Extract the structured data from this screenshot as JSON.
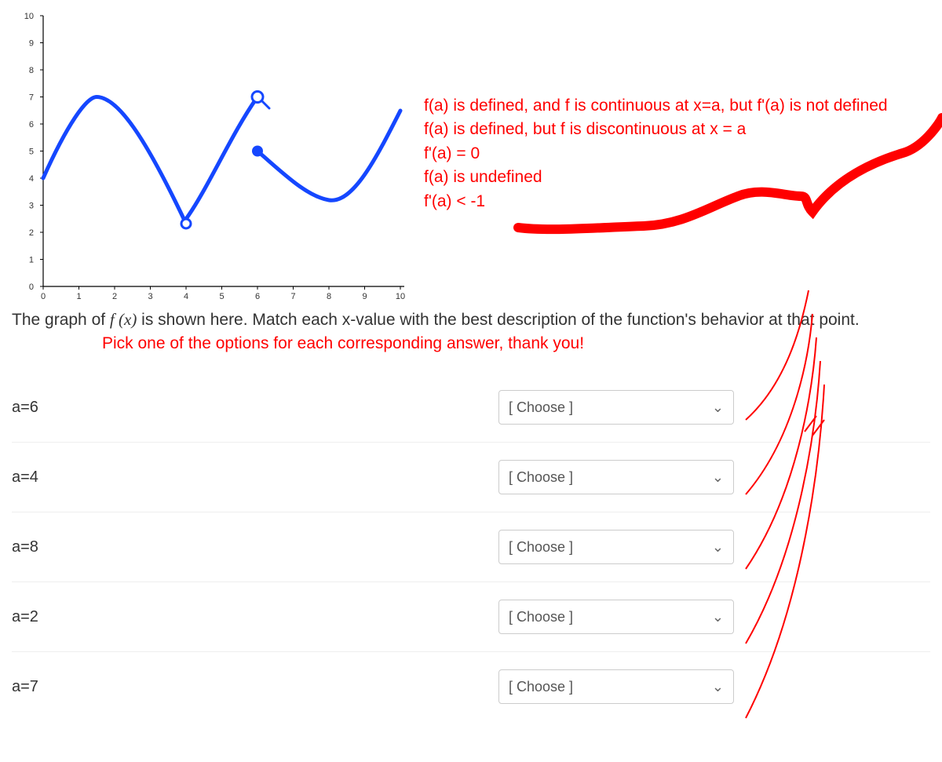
{
  "options": {
    "o1": "f(a) is defined, and f is continuous at x=a, but f'(a) is not defined",
    "o2": "f(a) is defined, but f is discontinuous at x = a",
    "o3": "f'(a) = 0",
    "o4": "f(a) is undefined",
    "o5": "f'(a) < -1"
  },
  "question": {
    "prefix": "The graph of ",
    "fn": "f (x)",
    "suffix": " is shown here. Match each x-value with the best description of the function's behavior at that point."
  },
  "sub_instruction": "Pick one of the options for each corresponding answer, thank you!",
  "rows": [
    {
      "label": "a=6",
      "choose": "[ Choose ]"
    },
    {
      "label": "a=4",
      "choose": "[ Choose ]"
    },
    {
      "label": "a=8",
      "choose": "[ Choose ]"
    },
    {
      "label": "a=2",
      "choose": "[ Choose ]"
    },
    {
      "label": "a=7",
      "choose": "[ Choose ]"
    }
  ],
  "chart_data": {
    "type": "line",
    "title": "",
    "xlabel": "",
    "ylabel": "",
    "xlim": [
      0,
      10
    ],
    "ylim": [
      0,
      10
    ],
    "x_ticks": [
      0,
      1,
      2,
      3,
      4,
      5,
      6,
      7,
      8,
      9,
      10
    ],
    "y_ticks": [
      0,
      1,
      2,
      3,
      4,
      5,
      6,
      7,
      8,
      9,
      10
    ],
    "series": [
      {
        "name": "f(x)",
        "segments": [
          {
            "x": [
              0,
              0.5,
              1.0,
              1.5,
              2.0,
              2.5,
              3.0,
              3.5,
              4.0
            ],
            "y": [
              4,
              5.8,
              6.6,
              7.0,
              6.6,
              5.8,
              4.6,
              3.3,
              2.3
            ],
            "open_start": false,
            "open_end": true
          },
          {
            "x": [
              4.0,
              4.5,
              5.0,
              5.5,
              6.0
            ],
            "y": [
              2.5,
              3.5,
              5.0,
              6.2,
              7.0
            ],
            "open_start": false,
            "open_end": false,
            "magnifier_at_6": true
          },
          {
            "x": [
              6.0,
              6.5,
              7.0,
              7.5,
              8.0,
              8.5,
              9.0,
              9.5,
              10.0
            ],
            "y": [
              5.0,
              4.3,
              3.8,
              3.4,
              3.2,
              3.6,
              4.5,
              5.6,
              6.5
            ],
            "open_start": false,
            "open_end": false,
            "filled_start": true
          }
        ]
      }
    ],
    "special_points": [
      {
        "x": 4,
        "y": 2.3,
        "type": "open"
      },
      {
        "x": 6,
        "y": 7.0,
        "type": "magnifier"
      },
      {
        "x": 6,
        "y": 5.0,
        "type": "filled"
      }
    ]
  }
}
